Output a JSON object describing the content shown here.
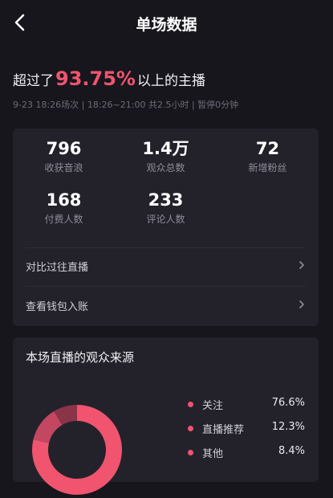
{
  "header": {
    "title": "单场数据"
  },
  "summary": {
    "prefix": "超过了",
    "percent": "93.75%",
    "suffix": "以上的主播"
  },
  "meta": "9-23 18:26场次 | 18:26~21:00 共2.5小时 | 暂停0分钟",
  "stats": [
    {
      "value": "796",
      "label": "收获音浪"
    },
    {
      "value": "1.4万",
      "label": "观众总数"
    },
    {
      "value": "72",
      "label": "新增粉丝"
    },
    {
      "value": "168",
      "label": "付费人数"
    },
    {
      "value": "233",
      "label": "评论人数"
    }
  ],
  "links": [
    {
      "label": "对比过往直播"
    },
    {
      "label": "查看钱包入账"
    }
  ],
  "audience_source": {
    "title": "本场直播的观众来源",
    "items": [
      {
        "name": "关注",
        "percent": "76.6%"
      },
      {
        "name": "直播推荐",
        "percent": "12.3%"
      },
      {
        "name": "其他",
        "percent": "8.4%"
      }
    ]
  },
  "colors": {
    "accent": "#f0546e",
    "accent_dark": "#8a3447",
    "card": "#23222b",
    "bg": "#17161d"
  },
  "chart_data": {
    "type": "pie",
    "categories": [
      "关注",
      "直播推荐",
      "其他"
    ],
    "values": [
      76.6,
      12.3,
      8.4
    ]
  }
}
